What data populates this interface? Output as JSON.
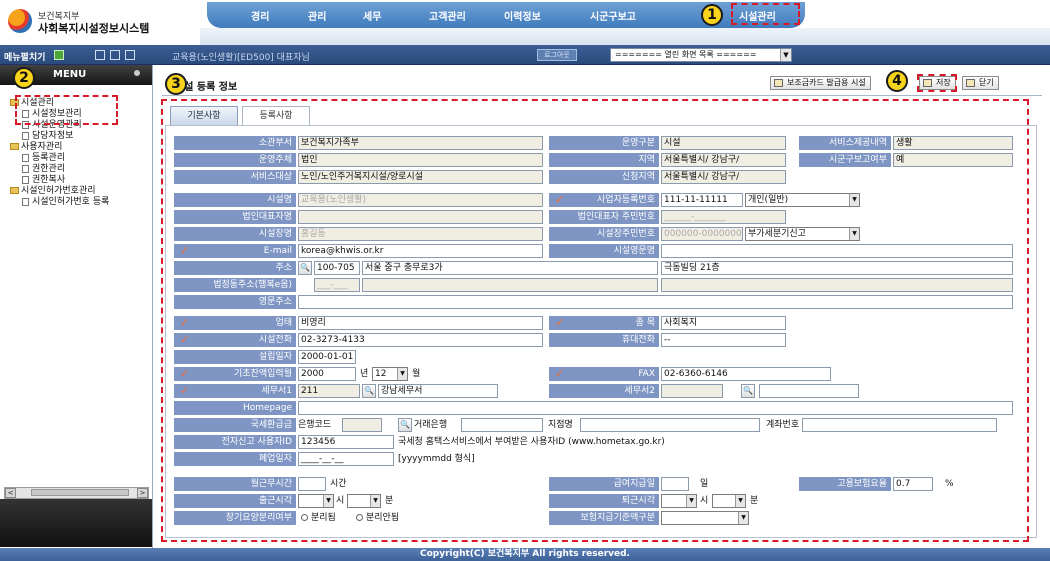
{
  "header": {
    "org": "보건복지부",
    "system_name": "사회복지시설정보시스템",
    "nav": [
      "경리",
      "관리",
      "세무",
      "고객관리",
      "이력정보",
      "시군구보고",
      "시설관리"
    ]
  },
  "menubar": {
    "menu_label": "메뉴펼치기",
    "crumb": "교육용(노인생활)[ED500] 대표자님",
    "logout": "로그아웃",
    "window_select": "======= 열린 화면 목록 ======"
  },
  "sidebar": {
    "title": "MENU",
    "tree": [
      {
        "label": "시설관리",
        "type": "folder"
      },
      {
        "label": "시설정보관리",
        "type": "doc"
      },
      {
        "label": "시설운영관리",
        "type": "doc"
      },
      {
        "label": "담당자정보",
        "type": "doc"
      },
      {
        "label": "사용자관리",
        "type": "folder"
      },
      {
        "label": "등록관리",
        "type": "doc"
      },
      {
        "label": "권한관리",
        "type": "doc"
      },
      {
        "label": "권한복사",
        "type": "doc"
      },
      {
        "label": "시설인허가번호관리",
        "type": "folder"
      },
      {
        "label": "시설인허가번호 등록",
        "type": "doc"
      }
    ]
  },
  "page": {
    "title": "시설 등록 정보",
    "btn_card": "보조금카드 발급용 시설",
    "btn_save": "저장",
    "btn_close": "닫기",
    "tabs": [
      "기본사항",
      "등록사항"
    ]
  },
  "form": {
    "so_gwan": {
      "label": "소관부서",
      "value": "보건복지가족부"
    },
    "unyeong_gubun": {
      "label": "운영구분",
      "value": "시설"
    },
    "service_content": {
      "label": "서비스제공내역",
      "value": "생활"
    },
    "unyeong_juche": {
      "label": "운영주체",
      "value": "법인"
    },
    "jiyeok": {
      "label": "지역",
      "value": "서울특별시/ 강남구/"
    },
    "sigungu_report": {
      "label": "시군구보고여부",
      "value": "예"
    },
    "service_target": {
      "label": "서비스대상",
      "value": "노인/노인주거복지시설/양로시설"
    },
    "sinchung_jiyeok": {
      "label": "신청지역",
      "value": "서울특별시/ 강남구/"
    },
    "sisulmyeong": {
      "label": "시설명",
      "value": "교육용(노인생활)"
    },
    "biz_no": {
      "label": "사업자등록번호",
      "value": "111-11-11111",
      "type": "개인(일반)"
    },
    "corp_rep": {
      "label": "법인대표자명",
      "value": ""
    },
    "corp_rep_id": {
      "label": "법인대표자 주민번호",
      "value": "______-_______"
    },
    "sisul_head": {
      "label": "시설장명",
      "value": "홍길동"
    },
    "head_id": {
      "label": "시설장주민번호",
      "value": "000000-0000000",
      "tax": "부가세분기신고"
    },
    "email": {
      "label": "E-mail",
      "value": "korea@khwis.or.kr"
    },
    "eng_name": {
      "label": "시설영문명",
      "value": ""
    },
    "address": {
      "label": "주소",
      "zip": "100-705",
      "addr1": "서울 중구 충무로3가",
      "addr2": "극동빌딩 21층"
    },
    "legal_address": {
      "label": "법정동주소(행복e음)",
      "zip": "___-___"
    },
    "eng_address": {
      "label": "영문주소",
      "value": ""
    },
    "uptae": {
      "label": "업태",
      "value": "비영리"
    },
    "jongmok": {
      "label": "종 목",
      "value": "사회복지"
    },
    "phone": {
      "label": "시설전화",
      "value": "02-3273-4133"
    },
    "mobile": {
      "label": "휴대전화",
      "value": "--"
    },
    "est_date": {
      "label": "설립일자",
      "value": "2000-01-01"
    },
    "base_month": {
      "label": "기초잔액입력월",
      "year": "2000",
      "year_unit": "년",
      "month": "12",
      "month_unit": "월"
    },
    "fax": {
      "label": "FAX",
      "value": "02-6360-6146"
    },
    "tax_office1": {
      "label": "세무서1",
      "code": "211",
      "name": "강남세무서"
    },
    "tax_office2": {
      "label": "세무서2",
      "code": "",
      "name": ""
    },
    "homepage": {
      "label": "Homepage",
      "value": ""
    },
    "refund": {
      "label": "국세환급금",
      "bank_code_label": "은행코드",
      "bank_label": "거래은행",
      "branch_label": "지점명",
      "account_label": "계좌번호"
    },
    "e_tax": {
      "label": "전자신고 사용자ID",
      "value": "123456",
      "note": "국세청 홈택스서비스에서 부여받은 사용자ID (www.hometax.go.kr)"
    },
    "close_date": {
      "label": "폐업일자",
      "value": "____-__-__",
      "hint": "[yyyymmdd 형식]"
    },
    "monthly_hours": {
      "label": "월근무시간",
      "unit": "시간"
    },
    "pay_day": {
      "label": "급여지급일",
      "unit": "일"
    },
    "insurance_rate": {
      "label": "고용보험요율",
      "value": "0.7",
      "unit": "%"
    },
    "start_time": {
      "label": "출근시각",
      "hour_unit": "시",
      "min_unit": "분"
    },
    "end_time": {
      "label": "퇴근시각",
      "hour_unit": "시",
      "min_unit": "분"
    },
    "ltc_split": {
      "label": "장기요양분리여부",
      "opt1": "분리됨",
      "opt2": "분리안됨"
    },
    "ins_std": {
      "label": "보험지급기준액구분"
    }
  },
  "annotations": [
    "1",
    "2",
    "3",
    "4"
  ],
  "footer": "Copyright(C) 보건복지부 All rights reserved.",
  "colors": {
    "label_bg": "#7f96c4",
    "nav_bg": "#3f7bbd",
    "annotation_red": "#d8192a",
    "annotation_yellow": "#f7d31b"
  }
}
